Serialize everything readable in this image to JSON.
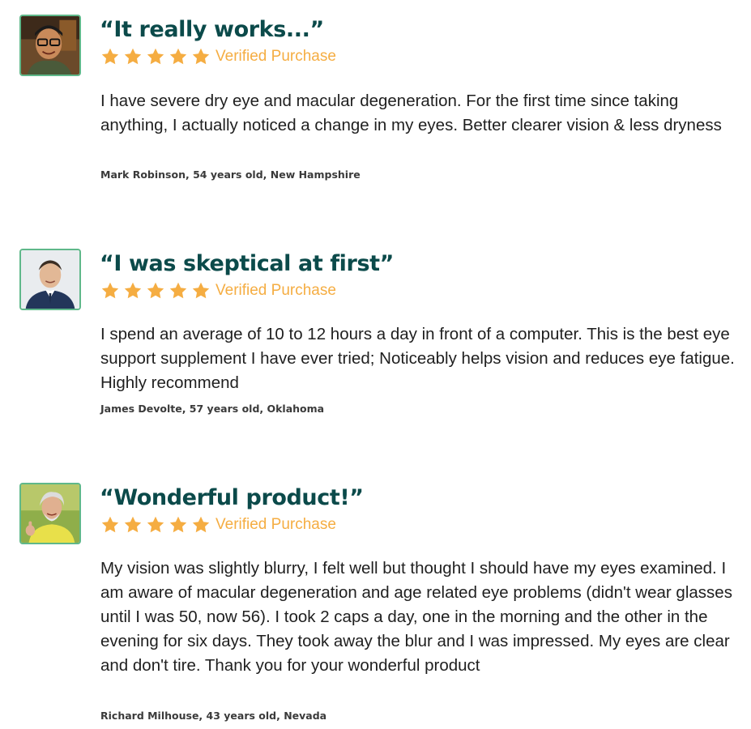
{
  "reviews": [
    {
      "title": "“It really works...”",
      "rating": 5,
      "verified_label": "Verified Purchase",
      "body": "I have severe dry eye and macular degeneration. For the first time since taking anything, I actually noticed a change in my eyes. Better clearer vision & less dryness",
      "author": "Mark Robinson, 54 years old, New Hampshire"
    },
    {
      "title": "“I was skeptical at first”",
      "rating": 5,
      "verified_label": "Verified Purchase",
      "body": "I spend an average of 10 to 12 hours a day in front of a computer. This is the best eye support supplement I have ever tried; Noticeably helps vision and reduces eye fatigue. Highly recommend",
      "author": "James Devolte, 57 years old, Oklahoma"
    },
    {
      "title": "“Wonderful product!”",
      "rating": 5,
      "verified_label": "Verified Purchase",
      "body": "My vision was slightly blurry, I felt well but thought I should have my eyes examined. I am aware of macular degeneration and age related eye problems (didn't wear glasses until I was 50, now 56). I took 2 caps a day, one in the morning and the other in the evening for six days. They took away the blur and I was impressed. My eyes are clear and don't tire. Thank you for your wonderful product",
      "author": "Richard Milhouse, 43 years old, Nevada"
    }
  ],
  "colors": {
    "title": "#0b4a4a",
    "star": "#f5ad42",
    "verified": "#f5ad42",
    "avatar_border": "#5fb88a",
    "body_text": "#1f1f1f",
    "author_text": "#3a3a3a"
  },
  "icons": {
    "star": "star-icon",
    "avatar": "reviewer-photo"
  }
}
